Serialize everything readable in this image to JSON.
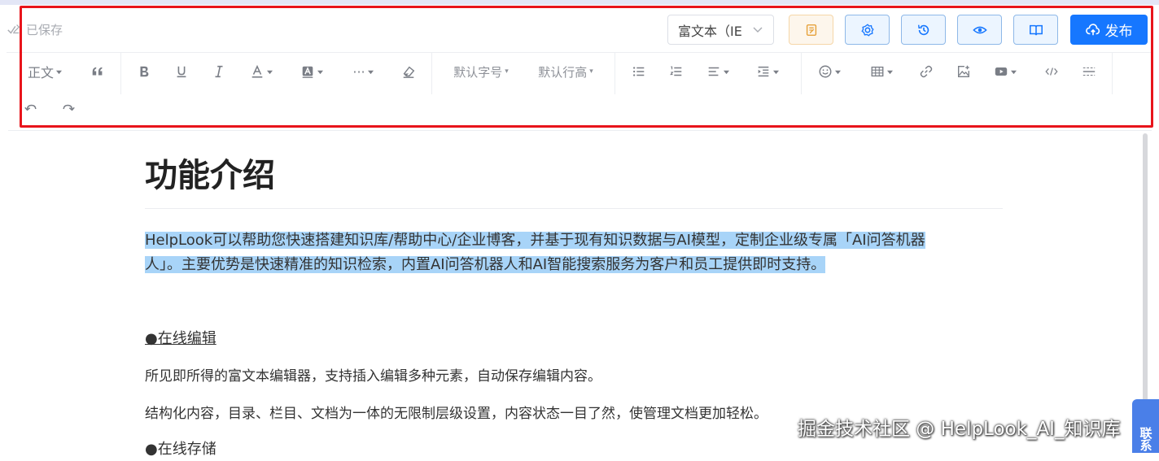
{
  "header": {
    "saved_label": "已保存",
    "mode_select_value": "富文本（IE",
    "publish_label": "发布",
    "buttons": [
      "notes-icon",
      "settings-icon",
      "history-icon",
      "preview-icon",
      "book-icon"
    ]
  },
  "toolbar": {
    "paragraph_label": "正文",
    "font_size_label": "默认字号",
    "line_height_label": "默认行高",
    "more_label": "···"
  },
  "document": {
    "title": "功能介绍",
    "intro_line1": "HelpLook可以帮助您快速搭建知识库/帮助中心/企业博客，并基于现有知识数据与AI模型，定制企业级专属「AI问答机器",
    "intro_line2": "人」。主要优势是快速精准的知识检索，内置AI问答机器人和AI智能搜索服务为客户和员工提供即时支持。",
    "section1_title": "●在线编辑",
    "section1_para1": "所见即所得的富文本编辑器，支持插入编辑多种元素，自动保存编辑内容。",
    "section1_para2": "结构化内容，目录、栏目、文档为一体的无限制层级设置，内容状态一目了然，使管理文档更加轻松。",
    "section2_title": "●在线存储"
  },
  "overlay": {
    "watermark": "掘金技术社区 @ HelpLook_AI_知识库",
    "side_tab": "联系"
  },
  "colors": {
    "accent": "#1677ff",
    "highlight_frame": "#e8141b",
    "text_selection": "#a8d4f8"
  }
}
